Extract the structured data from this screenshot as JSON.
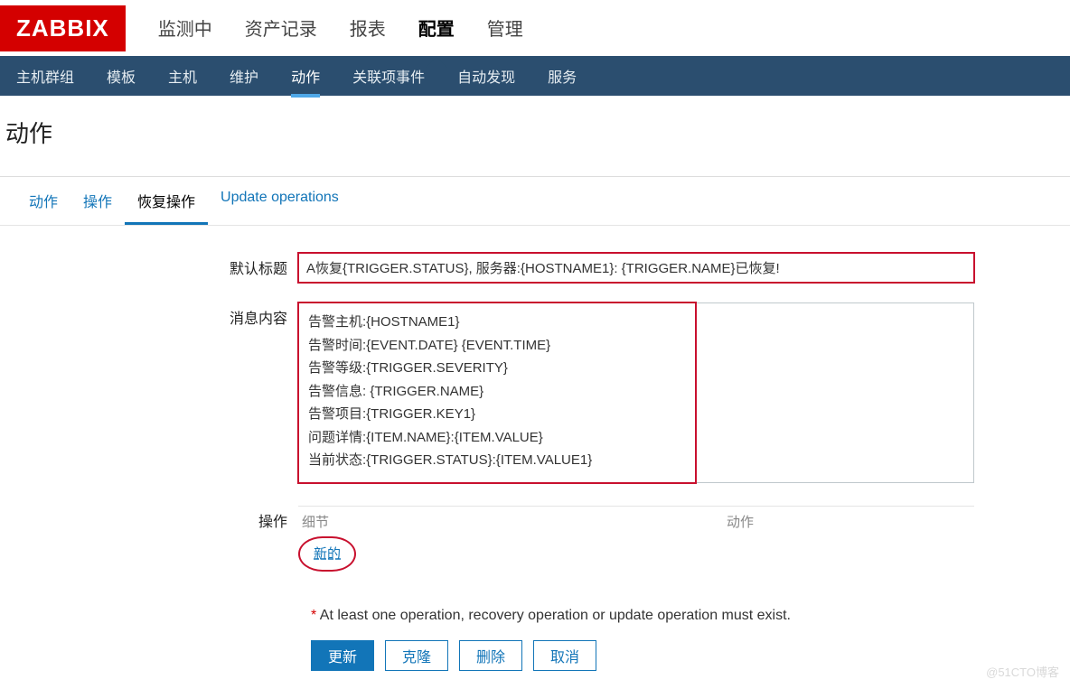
{
  "logo": "ZABBIX",
  "topnav": {
    "items": [
      "监测中",
      "资产记录",
      "报表",
      "配置",
      "管理"
    ],
    "active_index": 3
  },
  "subnav": {
    "items": [
      "主机群组",
      "模板",
      "主机",
      "维护",
      "动作",
      "关联项事件",
      "自动发现",
      "服务"
    ],
    "active_index": 4
  },
  "page_title": "动作",
  "tabs": {
    "items": [
      "动作",
      "操作",
      "恢复操作",
      "Update operations"
    ],
    "active_index": 2
  },
  "form": {
    "subject_label": "默认标题",
    "subject_value": "A恢复{TRIGGER.STATUS}, 服务器:{HOSTNAME1}: {TRIGGER.NAME}已恢复!",
    "message_label": "消息内容",
    "message_value": "告警主机:{HOSTNAME1}\n告警时间:{EVENT.DATE} {EVENT.TIME}\n告警等级:{TRIGGER.SEVERITY}\n告警信息: {TRIGGER.NAME}\n告警项目:{TRIGGER.KEY1}\n问题详情:{ITEM.NAME}:{ITEM.VALUE}\n当前状态:{TRIGGER.STATUS}:{ITEM.VALUE1}",
    "operations_label": "操作",
    "ops_col_detail": "细节",
    "ops_col_action": "动作",
    "new_label": "新的",
    "validation_text": "At least one operation, recovery operation or update operation must exist.",
    "buttons": {
      "update": "更新",
      "clone": "克隆",
      "delete": "删除",
      "cancel": "取消"
    }
  },
  "watermark": "@51CTO博客"
}
